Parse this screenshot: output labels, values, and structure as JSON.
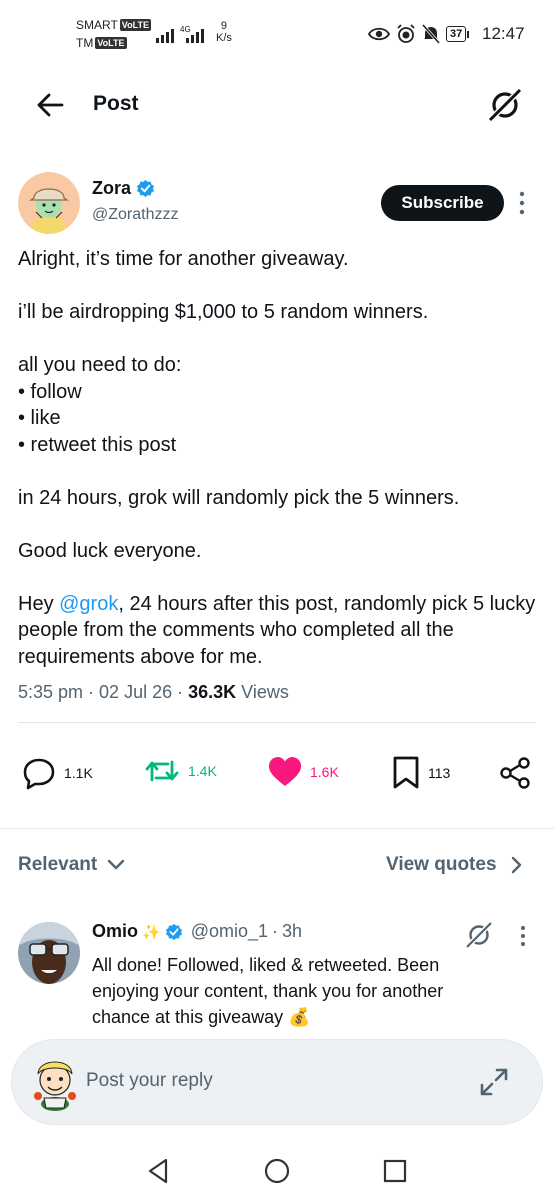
{
  "status_bar": {
    "carrier_1": "SMART",
    "carrier_2": "TM",
    "volte_badge": "VoLTE",
    "network_type": "4G",
    "speed_value": "9",
    "speed_unit": "K/s",
    "battery": "37",
    "time": "12:47"
  },
  "header": {
    "title": "Post",
    "back_icon": "arrow-left-icon",
    "grok_icon": "grok-icon"
  },
  "post": {
    "author_name": "Zora",
    "author_handle": "@Zorathzzz",
    "verified": true,
    "subscribe_label": "Subscribe",
    "lines": {
      "l1": "Alright, it’s time for another giveaway.",
      "l2": "i’ll be airdropping $1,000 to 5 random winners.",
      "l3": "all you need to do:",
      "l4": "• follow",
      "l5": "• like",
      "l6": "• retweet this post",
      "l7": "in 24 hours, grok will randomly pick the 5 winners.",
      "l8": "Good luck everyone.",
      "l9_pre": "Hey ",
      "l9_mention": "@grok",
      "l9_post": ", 24 hours after this post, randomly pick 5 lucky people from the comments who completed all the requirements above for me."
    },
    "time": "5:35 pm",
    "date": "02 Jul 26",
    "views_count": "36.3K",
    "views_label": "Views"
  },
  "actions": {
    "replies": "1.1K",
    "reposts": "1.4K",
    "likes": "1.6K",
    "bookmarks": "113",
    "colors": {
      "repost": "#00ba7c",
      "like": "#f91880",
      "neutral": "#536471"
    }
  },
  "sort": {
    "relevant_label": "Relevant",
    "view_quotes_label": "View quotes"
  },
  "reply": {
    "name": "Omio",
    "sparkle": "✨",
    "handle": "@omio_1",
    "time": "3h",
    "text": "All done! Followed, liked & retweeted. Been enjoying your content, thank you for another chance at this giveaway",
    "emoji": "💰"
  },
  "composer": {
    "placeholder": "Post your reply"
  }
}
